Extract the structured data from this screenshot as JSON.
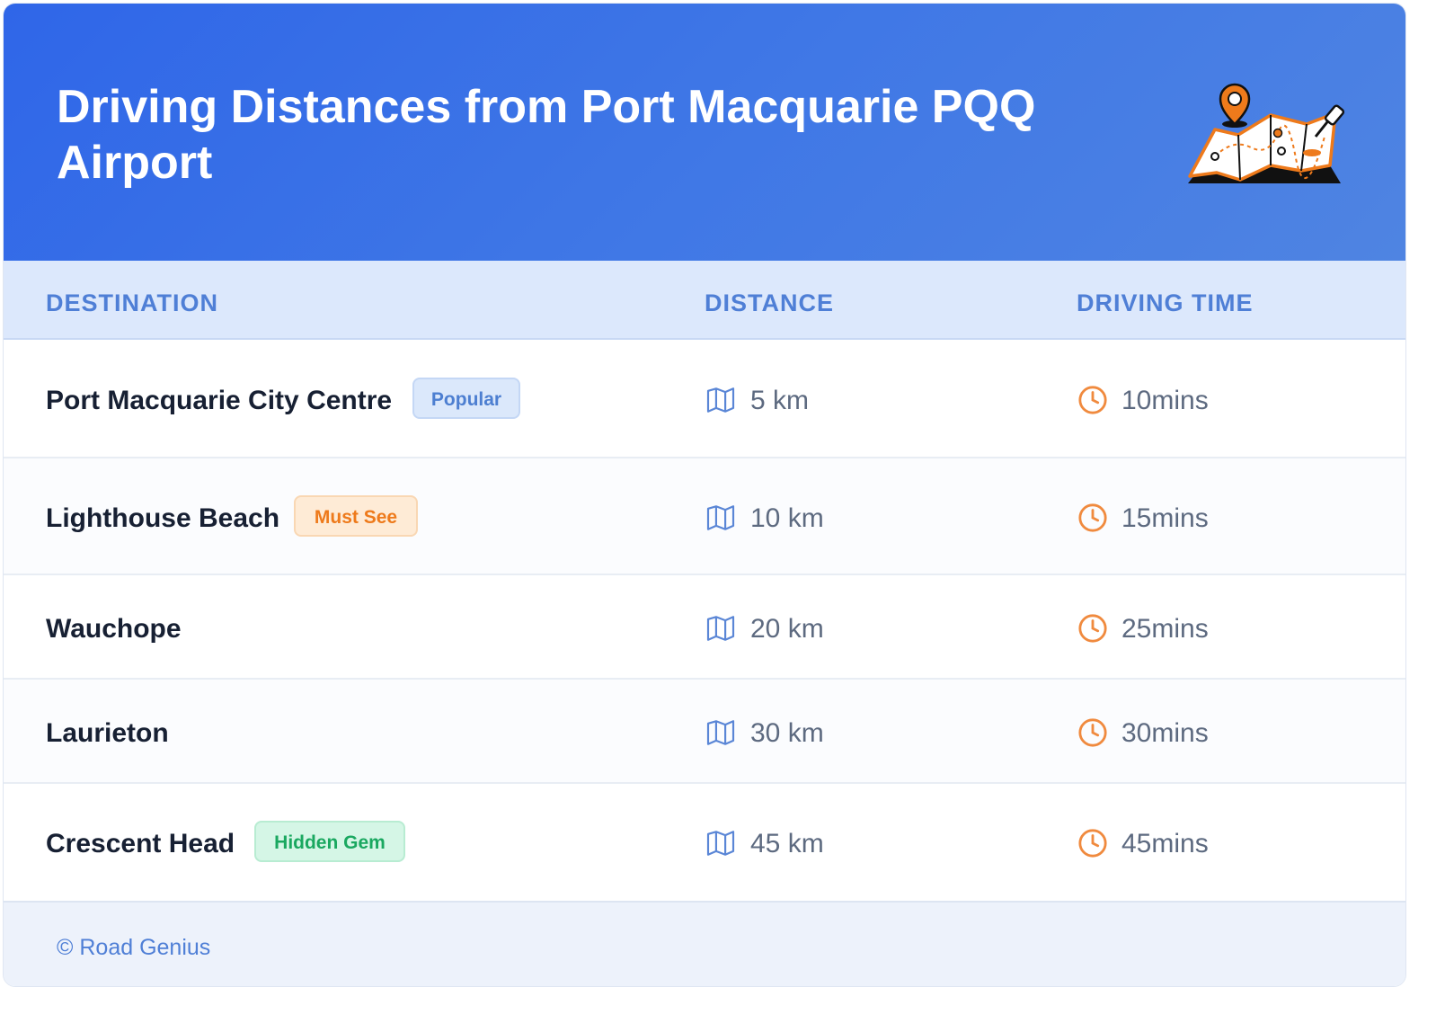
{
  "header": {
    "title": "Driving Distances from Port Macquarie PQQ Airport",
    "illustration_icon": "map-with-pins-icon"
  },
  "table": {
    "columns": [
      "DESTINATION",
      "DISTANCE",
      "DRIVING TIME"
    ],
    "rows": [
      {
        "destination": "Port Macquarie City Centre",
        "badge": "Popular",
        "badge_style": "blue",
        "distance": "5 km",
        "time": "10mins"
      },
      {
        "destination": "Lighthouse Beach",
        "badge": "Must See",
        "badge_style": "orange",
        "distance": "10 km",
        "time": "15mins"
      },
      {
        "destination": "Wauchope",
        "badge": "",
        "badge_style": "",
        "distance": "20 km",
        "time": "25mins"
      },
      {
        "destination": "Laurieton",
        "badge": "",
        "badge_style": "",
        "distance": "30 km",
        "time": "30mins"
      },
      {
        "destination": "Crescent Head",
        "badge": "Hidden Gem",
        "badge_style": "green",
        "distance": "45 km",
        "time": "45mins"
      }
    ]
  },
  "footer": {
    "copyright": "© Road Genius"
  },
  "colors": {
    "header_gradient_start": "#2f66e8",
    "header_gradient_end": "#4f84e2",
    "accent_blue": "#4f7fd6",
    "accent_orange": "#f08a3e",
    "accent_green": "#1aa860"
  }
}
